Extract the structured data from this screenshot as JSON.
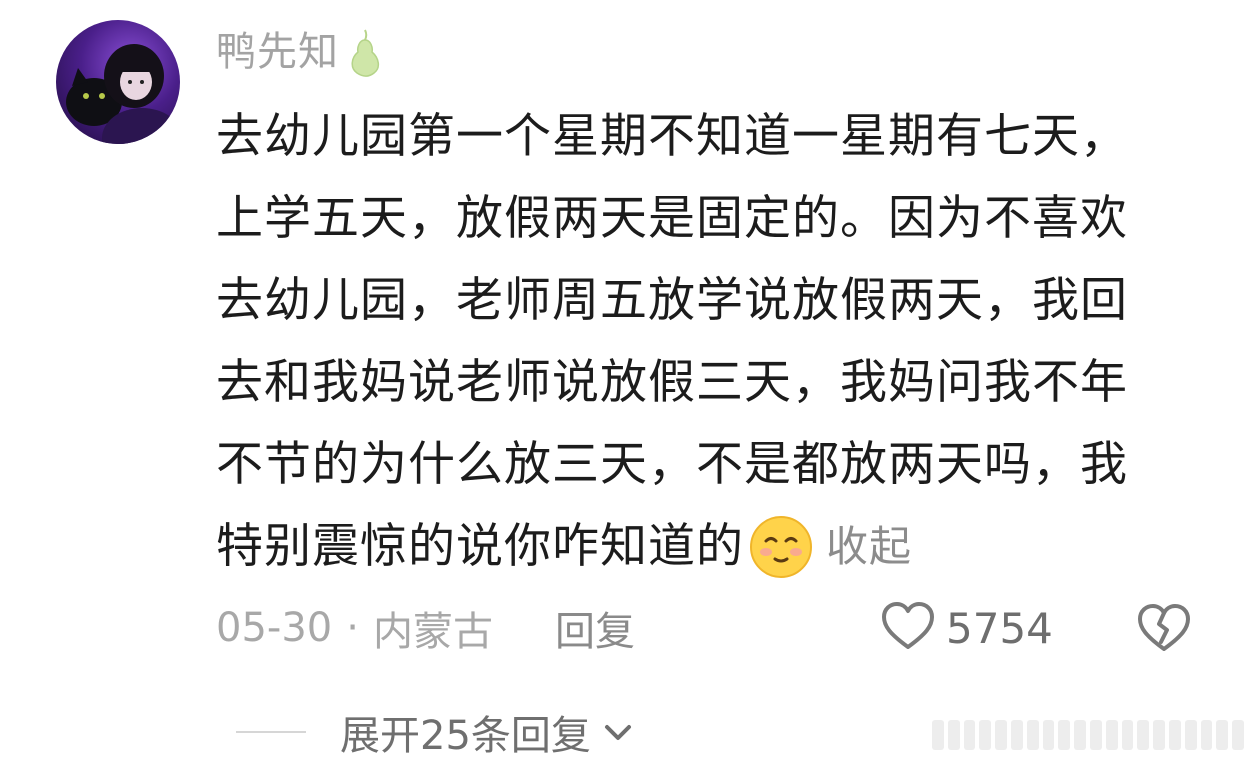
{
  "comment": {
    "username": "鸭先知",
    "badge_icon": "pear-icon",
    "text_lines": [
      "去幼儿园第一个星期不知道一星期有七天，",
      "上学五天，放假两天是固定的。因为不喜欢",
      "去幼儿园，老师周五放学说放假两天，我回",
      "去和我妈说老师说放假三天，我妈问我不年",
      "不节的为什么放三天，不是都放两天吗，我",
      "特别震惊的说你咋知道的"
    ],
    "emoji_icon": "shy-face-emoji-icon",
    "collapse_label": "收起",
    "date": "05-30",
    "separator": "·",
    "location": "内蒙古",
    "reply_label": "回复",
    "like_count": "5754",
    "like_icon": "heart-outline-icon",
    "dislike_icon": "broken-heart-icon"
  },
  "replies": {
    "expand_label": "展开25条回复",
    "expand_icon": "chevron-down-icon"
  },
  "colors": {
    "text_primary": "#1c1c1c",
    "text_secondary": "#a8a8a8",
    "avatar_purple": "#6a2fb8"
  }
}
